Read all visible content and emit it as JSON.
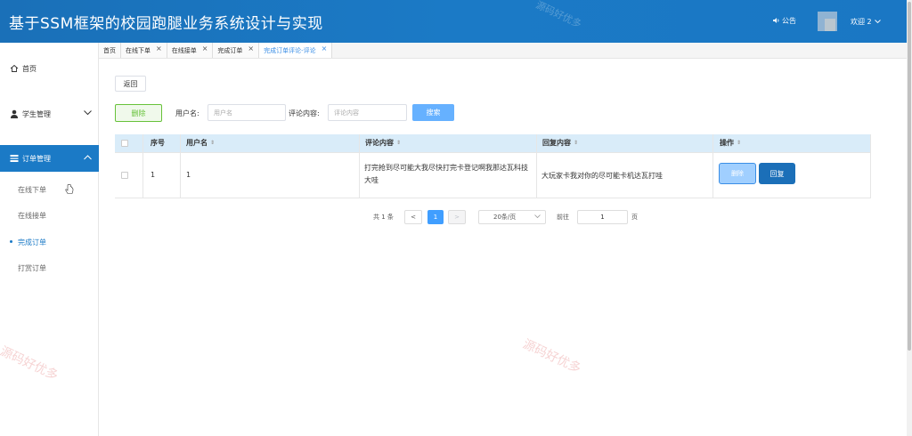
{
  "app": {
    "title": "基于SSM框架的校园跑腿业务系统设计与实现",
    "notice_label": "公告",
    "welcome_label": "欢迎 2"
  },
  "sidebar": {
    "home": "首页",
    "student_mgmt": "学生管理",
    "order_mgmt": "订单管理",
    "sub_items": [
      "在线下单",
      "在线接单",
      "完成订单",
      "打赏订单"
    ]
  },
  "tabs": [
    {
      "label": "首页"
    },
    {
      "label": "在线下单"
    },
    {
      "label": "在线接单"
    },
    {
      "label": "完成订单"
    },
    {
      "label": "完成订单评论-评论"
    }
  ],
  "toolbar": {
    "back_label": "返回",
    "delete_label": "删除",
    "username_label": "用户名:",
    "username_placeholder": "用户名",
    "comment_label": "评论内容:",
    "comment_placeholder": "评论内容",
    "search_label": "搜索"
  },
  "table": {
    "headers": {
      "index": "序号",
      "username": "用户名",
      "comment": "评论内容",
      "reply": "回复内容",
      "actions": "操作"
    },
    "rows": [
      {
        "index": "1",
        "username": "1",
        "comment": "打完抢到尽可能大我尽快打完卡登记啊我那达瓦科技大哇",
        "reply": "大玩家卡我对你的尽可能卡机达瓦打哇",
        "delete_label": "删除",
        "reply_label": "回复"
      }
    ]
  },
  "pagination": {
    "total_label": "共 1 条",
    "prev": "<",
    "current_page": "1",
    "next": ">",
    "page_size": "20条/页",
    "goto_label": "前往",
    "goto_value": "1",
    "page_suffix": "页"
  },
  "watermark": "源码好优多",
  "colors": {
    "header": "#1b7ac6",
    "primary": "#409eff",
    "success": "#67c23a",
    "table_header": "#d9ecf9"
  }
}
